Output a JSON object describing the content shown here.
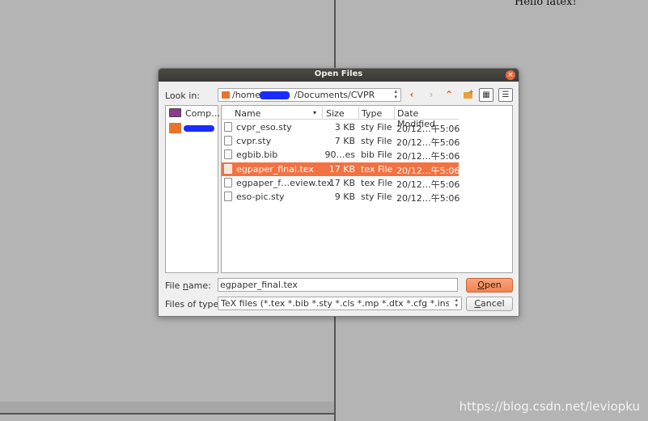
{
  "background": {
    "preview_text": "Hello latex!",
    "watermark": "https://blog.csdn.net/leviopku"
  },
  "dialog": {
    "title": "Open Files",
    "close_glyph": "×",
    "look_in_label": "Look in:",
    "path_prefix": "/home/",
    "path_suffix": "/Documents/CVPR",
    "toolbar": {
      "back_icon": "‹",
      "forward_icon": "›",
      "up_icon": "⌃",
      "list_icon": "▦",
      "details_icon": "☰"
    },
    "places": [
      {
        "label": "Comp…",
        "icon": "computer-icon"
      },
      {
        "label": "",
        "icon": "home-folder-icon"
      }
    ],
    "columns": [
      "Name",
      "Size",
      "Type",
      "Date Modified"
    ],
    "sort_glyph": "▾",
    "files": [
      {
        "name": "cvpr_eso.sty",
        "size": "3 KB",
        "type": "sty File",
        "date": "20/12…午5:06",
        "selected": false
      },
      {
        "name": "cvpr.sty",
        "size": "7 KB",
        "type": "sty File",
        "date": "20/12…午5:06",
        "selected": false
      },
      {
        "name": "egbib.bib",
        "size": "90…es",
        "type": "bib File",
        "date": "20/12…午5:06",
        "selected": false
      },
      {
        "name": "egpaper_final.tex",
        "size": "17 KB",
        "type": "tex File",
        "date": "20/12…午5:06",
        "selected": true
      },
      {
        "name": "egpaper_f…eview.tex",
        "size": "17 KB",
        "type": "tex File",
        "date": "20/12…午5:06",
        "selected": false
      },
      {
        "name": "eso-pic.sty",
        "size": "9 KB",
        "type": "sty File",
        "date": "20/12…午5:06",
        "selected": false
      }
    ],
    "file_name_label_pre": "File ",
    "file_name_label_u": "n",
    "file_name_label_post": "ame:",
    "file_name_value": "egpaper_final.tex",
    "open_label_u": "O",
    "open_label_rest": "pen",
    "file_type_label": "Files of type:",
    "file_type_value": "TeX files (*.tex *.bib *.sty *.cls *.mp *.dtx *.cfg *.ins *.ltx *.tik",
    "cancel_label_u": "C",
    "cancel_label_rest": "ancel",
    "colors": {
      "accent": "#f27241",
      "title_bar": "#3e3d39"
    }
  }
}
